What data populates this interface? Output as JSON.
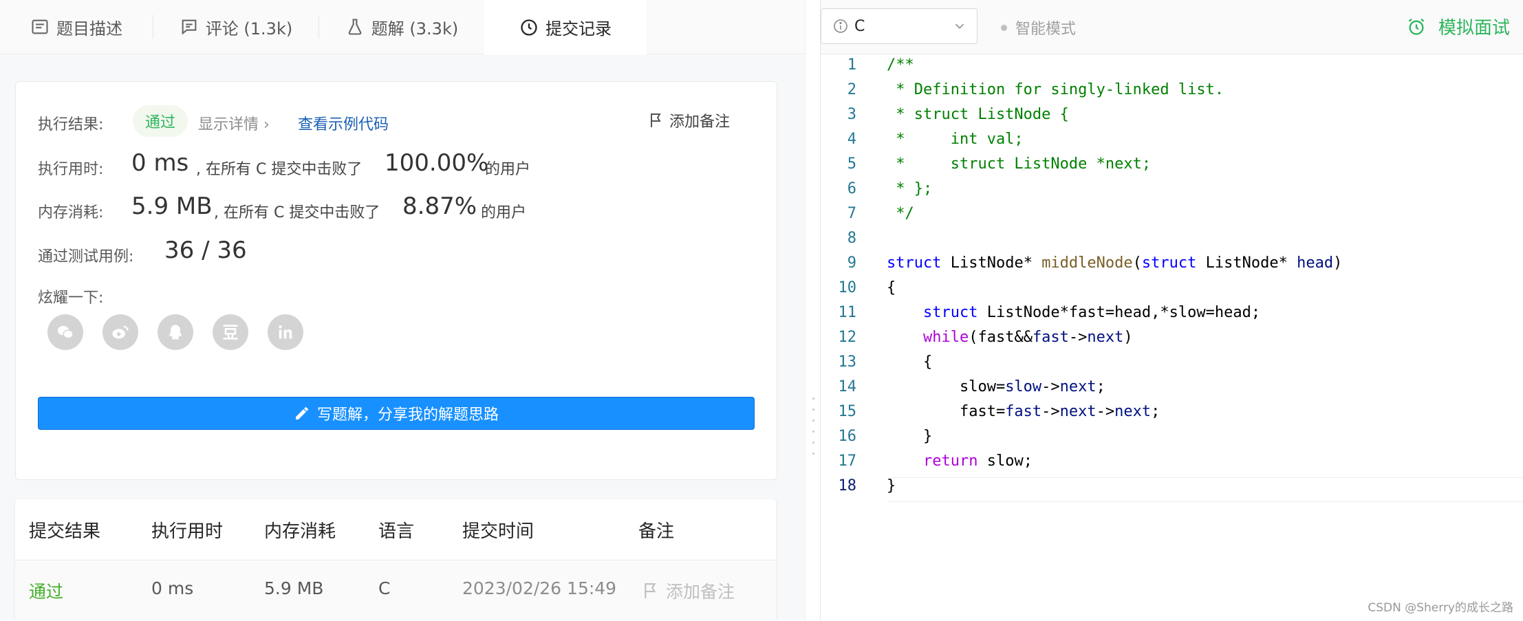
{
  "tabs": [
    {
      "label": "题目描述",
      "icon": "description-icon"
    },
    {
      "label": "评论 (1.3k)",
      "icon": "comment-icon"
    },
    {
      "label": "题解 (3.3k)",
      "icon": "flask-icon"
    },
    {
      "label": "提交记录",
      "icon": "clock-icon"
    }
  ],
  "result": {
    "status_label": "执行结果:",
    "status": "通过",
    "detail_link": "显示详情 ›",
    "sample_link": "查看示例代码",
    "add_note": "添加备注",
    "runtime_label": "执行用时:",
    "runtime_value": "0 ms",
    "runtime_text": ", 在所有 C 提交中击败了",
    "runtime_percent": "100.00%",
    "runtime_suffix": "的用户",
    "memory_label": "内存消耗:",
    "memory_value": "5.9 MB",
    "memory_text": ", 在所有 C 提交中击败了",
    "memory_percent": "8.87%",
    "memory_suffix": "的用户",
    "tests_label": "通过测试用例:",
    "tests_value": "36 / 36",
    "share_label": "炫耀一下:",
    "share_icons": [
      "wechat-icon",
      "weibo-icon",
      "qq-icon",
      "douban-icon",
      "linkedin-icon"
    ],
    "write_button": "写题解，分享我的解题思路"
  },
  "submissions": {
    "headers": [
      "提交结果",
      "执行用时",
      "内存消耗",
      "语言",
      "提交时间",
      "备注"
    ],
    "rows": [
      {
        "result": "通过",
        "runtime": "0 ms",
        "memory": "5.9 MB",
        "language": "C",
        "time": "2023/02/26 15:49",
        "note": "添加备注"
      }
    ]
  },
  "editor": {
    "language": "C",
    "smart_mode": "智能模式",
    "mock_interview": "模拟面试",
    "line_numbers": [
      "1",
      "2",
      "3",
      "4",
      "5",
      "6",
      "7",
      "8",
      "9",
      "10",
      "11",
      "12",
      "13",
      "14",
      "15",
      "16",
      "17",
      "18"
    ],
    "code": [
      "/**",
      " * Definition for singly-linked list.",
      " * struct ListNode {",
      " *     int val;",
      " *     struct ListNode *next;",
      " * };",
      " */",
      "",
      "struct ListNode* middleNode(struct ListNode* head)",
      "{",
      "    struct ListNode*fast=head,*slow=head;",
      "    while(fast&&fast->next)",
      "    {",
      "        slow=slow->next;",
      "        fast=fast->next->next;",
      "    }",
      "    return slow;",
      "}"
    ]
  },
  "watermark": "CSDN @Sherry的成长之路",
  "colors": {
    "accent_green": "#2db55d",
    "primary_blue": "#1890ff",
    "link_blue": "#1a5fb4"
  }
}
